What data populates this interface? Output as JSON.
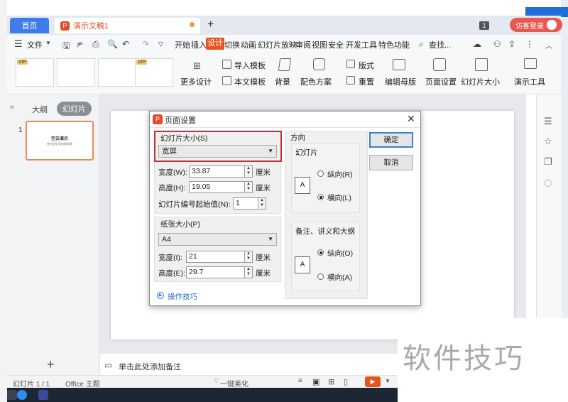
{
  "titlebar": {
    "home_tab": "首页",
    "doc_tab": "演示文稿1",
    "plus": "+",
    "badge": "1",
    "login": "访客登录"
  },
  "menu": {
    "file": "文件",
    "search": "查找...",
    "items": [
      "开始",
      "插入",
      "设计",
      "切换",
      "动画",
      "幻灯片放映",
      "审阅",
      "视图",
      "安全",
      "开发工具",
      "特色功能"
    ]
  },
  "ribbon": {
    "vip": "VIP",
    "more_design": "更多设计",
    "import_template": "导入模板",
    "this_template": "本文模板",
    "background": "背景",
    "color_scheme": "配色方案",
    "layout": "版式",
    "reset": "重置",
    "edit_master": "编辑母版",
    "page_setup": "页面设置",
    "slide_size": "幻灯片大小",
    "presentation_tools": "演示工具"
  },
  "left_panel": {
    "outline_tab": "大纲",
    "slides_tab": "幻灯片",
    "slide_number": "1",
    "thumb_title": "空白演示",
    "thumb_subtitle": "单击此处添加副标题",
    "add_slide": "+"
  },
  "notes": {
    "placeholder": "单击此处添加备注"
  },
  "status": {
    "slide_info": "幻灯片 1 / 1",
    "theme": "Office 主题",
    "beautify": "一键美化"
  },
  "dialog": {
    "title": "页面设置",
    "slide_size_label": "幻灯片大小(S)",
    "slide_size_value": "宽屏",
    "width_label": "宽度(W):",
    "width_value": "33.87",
    "height_label": "高度(H):",
    "height_value": "19.05",
    "unit": "厘米",
    "start_number_label": "幻灯片编号起始值(N):",
    "start_number_value": "1",
    "paper_size_label": "纸张大小(P)",
    "paper_size_value": "A4",
    "paper_width_label": "宽度(I):",
    "paper_width_value": "21",
    "paper_height_label": "高度(E):",
    "paper_height_value": "29.7",
    "orientation_label": "方向",
    "slides_label": "幻灯片",
    "portrait_r": "纵向(R)",
    "landscape_l": "横向(L)",
    "notes_label": "备注、讲义和大纲",
    "portrait_o": "纵向(O)",
    "landscape_a": "横向(A)",
    "ok": "确定",
    "cancel": "取消",
    "tips": "操作技巧",
    "page_glyph": "A"
  },
  "watermark": "软件技巧"
}
